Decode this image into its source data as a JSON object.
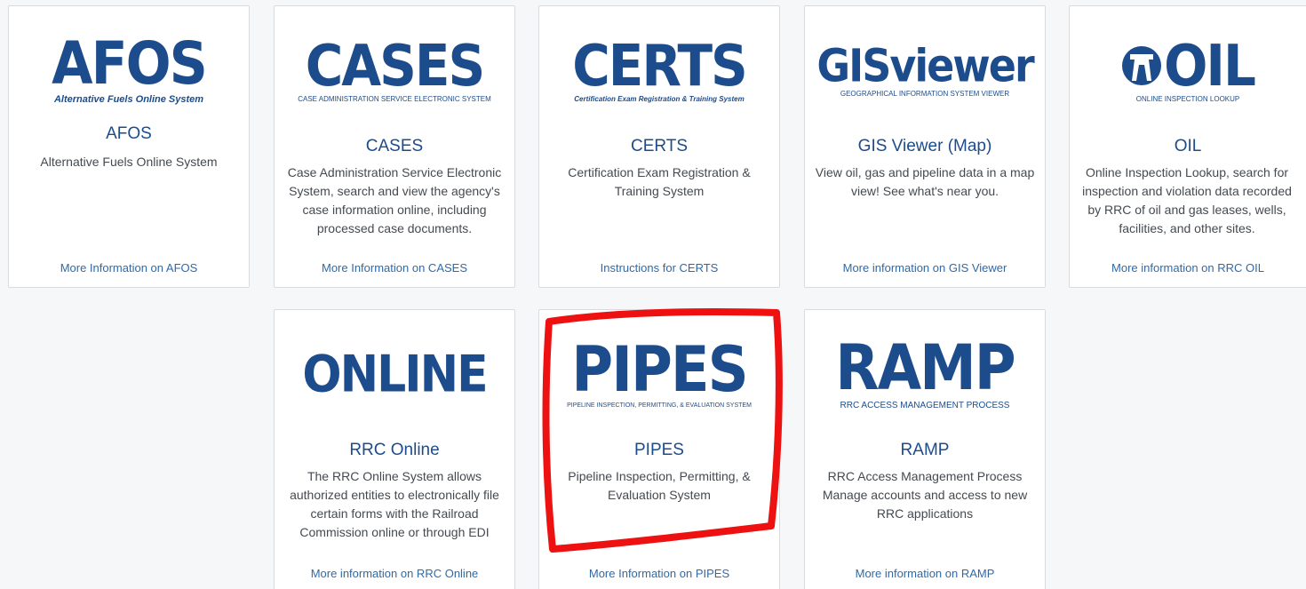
{
  "cards": {
    "afos": {
      "logo": "AFOS",
      "logo_sub": "Alternative Fuels Online System",
      "title": "AFOS",
      "description": "Alternative Fuels Online System",
      "link": "More Information on AFOS"
    },
    "cases": {
      "logo": "CASES",
      "logo_sub": "Case Administration Service Electronic System",
      "title": "CASES",
      "description": "Case Administration Service Electronic System, search and view the agency's case information online, including processed case documents.",
      "link": "More Information on CASES"
    },
    "certs": {
      "logo": "CERTS",
      "logo_sub": "Certification Exam Registration & Training System",
      "title": "CERTS",
      "description": "Certification Exam Registration & Training System",
      "link": "Instructions for CERTS"
    },
    "gis": {
      "logo": "GISviewer",
      "logo_sub": "Geographical Information System Viewer",
      "title": "GIS Viewer (Map)",
      "description": "View oil, gas and pipeline data in a map view! See what's near you.",
      "link": "More information on GIS Viewer"
    },
    "oil": {
      "logo": "OIL",
      "logo_sub": "Online Inspection Lookup",
      "title": "OIL",
      "description": "Online Inspection Lookup, search for inspection and violation data recorded by RRC of oil and gas leases, wells, facilities, and other sites.",
      "link": "More information on RRC OIL"
    },
    "online": {
      "logo": "ONLINE",
      "title": "RRC Online",
      "description": "The RRC Online System allows authorized entities to electronically file certain forms with the Railroad Commission online or through EDI",
      "link": "More information on RRC Online"
    },
    "pipes": {
      "logo": "PIPES",
      "logo_sub": "Pipeline Inspection, Permitting, & Evaluation System",
      "title": "PIPES",
      "description": "Pipeline Inspection, Permitting, & Evaluation System",
      "link": "More Information on PIPES"
    },
    "ramp": {
      "logo": "RAMP",
      "logo_sub": "RRC Access Management Process",
      "title": "RAMP",
      "description": "RRC Access Management Process Manage accounts and access to new RRC applications",
      "link": "More information on RAMP"
    }
  },
  "colors": {
    "brand_blue": "#1c4c8c",
    "link_blue": "#2f6aa8",
    "highlight_red": "#ee1111"
  }
}
